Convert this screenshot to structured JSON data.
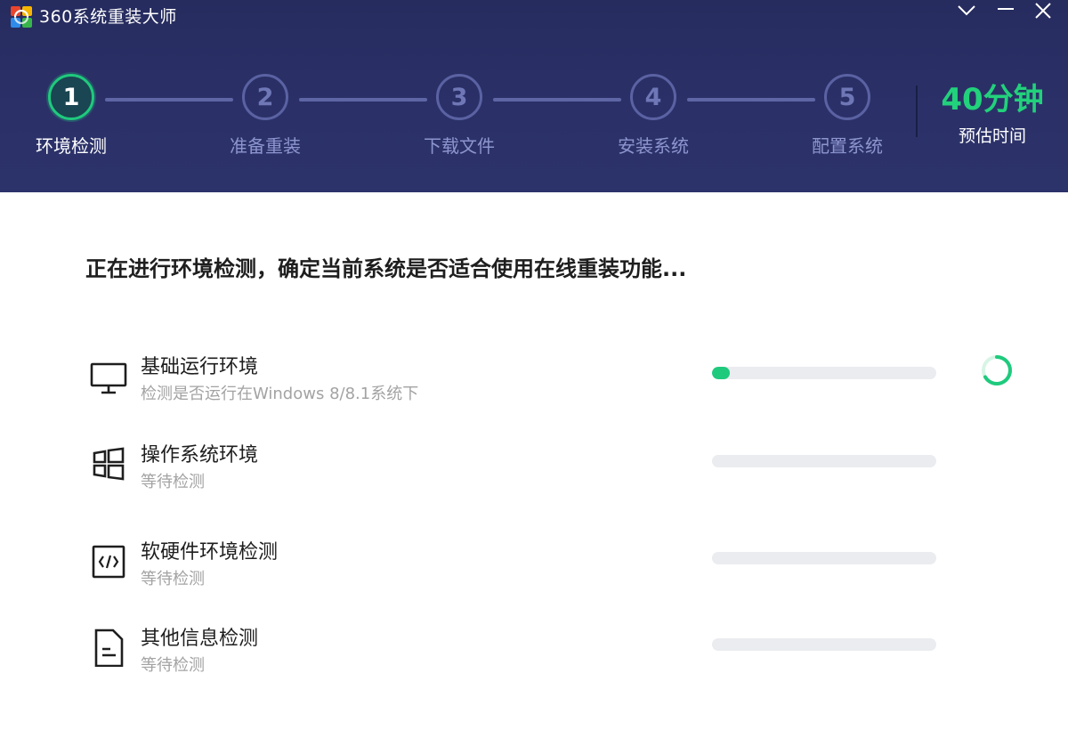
{
  "titlebar": {
    "title": "360系统重装大师",
    "controls": [
      "chevron-down-icon",
      "minimize-icon",
      "close-icon"
    ]
  },
  "steps": [
    {
      "number": "1",
      "label": "环境检测",
      "active": true
    },
    {
      "number": "2",
      "label": "准备重装",
      "active": false
    },
    {
      "number": "3",
      "label": "下载文件",
      "active": false
    },
    {
      "number": "4",
      "label": "安装系统",
      "active": false
    },
    {
      "number": "5",
      "label": "配置系统",
      "active": false
    }
  ],
  "eta": {
    "value": "40分钟",
    "label": "预估时间"
  },
  "headline": "正在进行环境检测，确定当前系统是否适合使用在线重装功能...",
  "checks": [
    {
      "title": "基础运行环境",
      "status": "检测是否运行在Windows 8/8.1系统下",
      "progress": 0.08,
      "icon": "monitor-icon",
      "in_progress": true
    },
    {
      "title": "操作系统环境",
      "status": "等待检测",
      "progress": 0,
      "icon": "windows-icon",
      "in_progress": false
    },
    {
      "title": "软硬件环境检测",
      "status": "等待检测",
      "progress": 0,
      "icon": "code-icon",
      "in_progress": false
    },
    {
      "title": "其他信息检测",
      "status": "等待检测",
      "progress": 0,
      "icon": "document-icon",
      "in_progress": false
    }
  ],
  "colors": {
    "header_bg": "#2b3168",
    "accent_green": "#1fca7d",
    "eta_green": "#22d17b",
    "inactive_step": "#5b62a3",
    "track": "#eaecef"
  }
}
